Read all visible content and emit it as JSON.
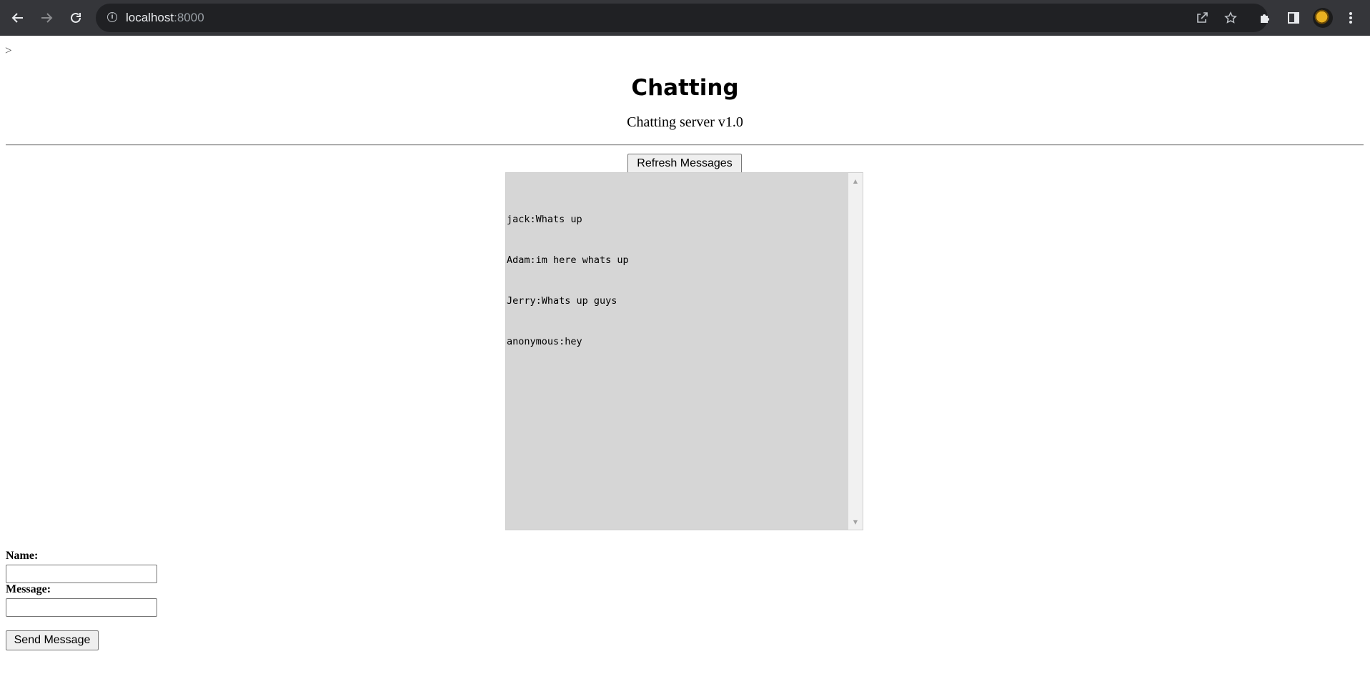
{
  "browser": {
    "url_host": "localhost",
    "url_port": ":8000",
    "icons": {
      "back": "back-arrow-icon",
      "forward": "forward-arrow-icon",
      "reload": "reload-icon",
      "info": "info-icon",
      "share": "share-icon",
      "bookmark": "star-icon",
      "extensions": "puzzle-icon",
      "side_panel": "side-panel-icon",
      "profile": "avatar",
      "menu": "kebab-menu-icon"
    }
  },
  "page": {
    "stray_text": ">",
    "title": "Chatting",
    "subtitle": "Chatting server v1.0",
    "refresh_button": "Refresh Messages",
    "messages": [
      "jack:Whats up",
      "Adam:im here whats up",
      "Jerry:Whats up guys",
      "anonymous:hey"
    ],
    "form": {
      "name_label": "Name:",
      "name_value": "",
      "message_label": "Message:",
      "message_value": "",
      "send_button": "Send Message"
    }
  },
  "colors": {
    "chrome_bg": "#35363a",
    "omnibox_bg": "#202124",
    "chatbox_bg": "#d6d6d6"
  }
}
